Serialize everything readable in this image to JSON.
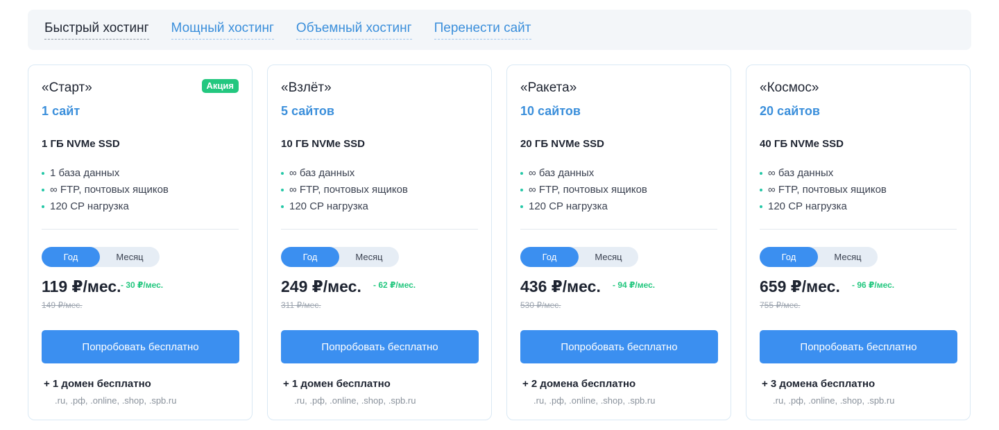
{
  "tabs": [
    {
      "label": "Быстрый хостинг",
      "active": true
    },
    {
      "label": "Мощный хостинг",
      "active": false
    },
    {
      "label": "Объемный хостинг",
      "active": false
    },
    {
      "label": "Перенести сайт",
      "active": false
    }
  ],
  "period": {
    "year": "Год",
    "month": "Месяц"
  },
  "cta_label": "Попробовать бесплатно",
  "zones": ".ru, .рф, .online, .shop, .spb.ru",
  "colors": {
    "accent": "#3b8ff0",
    "link": "#3b8fdb",
    "promo": "#23c77f"
  },
  "plans": [
    {
      "title": "«Старт»",
      "badge": "Акция",
      "sites": "1 сайт",
      "storage": "1 ГБ NVMe SSD",
      "features": [
        "1 база данных",
        "∞ FTP, почтовых ящиков",
        "120 CP нагрузка"
      ],
      "price": "119 ₽/мес.",
      "discount": "- 30 ₽/мес.",
      "old_price": "149 ₽/мес.",
      "domains": "+ 1 домен бесплатно"
    },
    {
      "title": "«Взлёт»",
      "sites": "5 сайтов",
      "storage": "10 ГБ NVMe SSD",
      "features": [
        "∞ баз данных",
        "∞ FTP, почтовых ящиков",
        "120 CP нагрузка"
      ],
      "price": "249 ₽/мес.",
      "discount": "- 62 ₽/мес.",
      "old_price": "311 ₽/мес.",
      "domains": "+ 1 домен бесплатно"
    },
    {
      "title": "«Ракета»",
      "sites": "10 сайтов",
      "storage": "20 ГБ NVMe SSD",
      "features": [
        "∞ баз данных",
        "∞ FTP, почтовых ящиков",
        "120 CP нагрузка"
      ],
      "price": "436 ₽/мес.",
      "discount": "- 94 ₽/мес.",
      "old_price": "530 ₽/мес.",
      "domains": "+ 2 домена бесплатно"
    },
    {
      "title": "«Космос»",
      "sites": "20 сайтов",
      "storage": "40 ГБ NVMe SSD",
      "features": [
        "∞ баз данных",
        "∞ FTP, почтовых ящиков",
        "120 CP нагрузка"
      ],
      "price": "659 ₽/мес.",
      "discount": "- 96 ₽/мес.",
      "old_price": "755 ₽/мес.",
      "domains": "+ 3 домена бесплатно"
    }
  ]
}
